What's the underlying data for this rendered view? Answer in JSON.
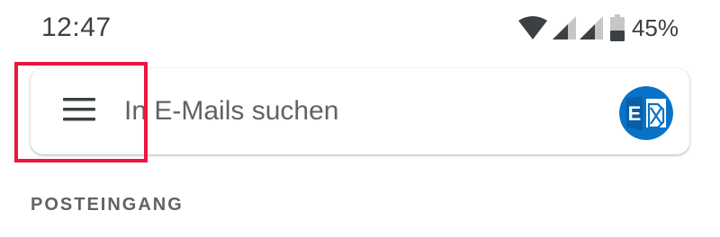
{
  "status_bar": {
    "time": "12:47",
    "battery_percent": "45%",
    "battery_level": 0.45,
    "icons": [
      "wifi-icon",
      "signal-icon",
      "signal-icon",
      "battery-icon"
    ]
  },
  "search_bar": {
    "menu_icon": "hamburger-menu-icon",
    "placeholder": "In E-Mails suchen",
    "avatar_icon": "exchange-icon"
  },
  "section": {
    "title": "POSTEINGANG"
  },
  "annotation": {
    "highlight_color": "#e8173d"
  },
  "colors": {
    "text_primary": "#3c4043",
    "text_secondary": "#5f6368",
    "exchange_blue": "#0a72c6"
  }
}
